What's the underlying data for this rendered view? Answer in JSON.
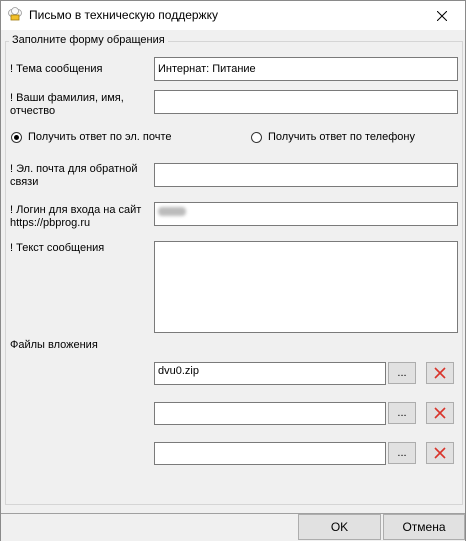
{
  "window": {
    "title": "Письмо в техническую поддержку"
  },
  "group": {
    "title": "Заполните форму обращения"
  },
  "subject": {
    "label": "! Тема сообщения",
    "value": "Интернат: Питание"
  },
  "name": {
    "label_line1": "! Ваши фамилия, имя,",
    "label_line2": "отчество",
    "value": ""
  },
  "reply": {
    "email_label": "Получить ответ по эл. почте",
    "phone_label": "Получить ответ по телефону",
    "selected": "email"
  },
  "email": {
    "label_line1": "! Эл. почта для обратной",
    "label_line2": "связи",
    "value": ""
  },
  "login": {
    "label_line1": "! Логин для входа на сайт",
    "label_line2": "https://pbprog.ru"
  },
  "message": {
    "label": "! Текст сообщения",
    "value": ""
  },
  "attachments": {
    "label": "Файлы вложения",
    "browse_label": "...",
    "files": [
      "dvu0.zip",
      "",
      ""
    ]
  },
  "buttons": {
    "ok": "OK",
    "cancel": "Отмена"
  },
  "icons": {
    "app": "chef-hat-icon",
    "close": "close-icon",
    "delete": "red-x-icon"
  },
  "colors": {
    "delete_icon": "#d9342b"
  }
}
